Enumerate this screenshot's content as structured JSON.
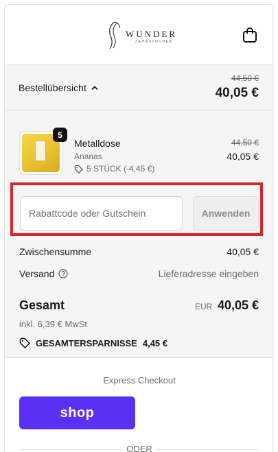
{
  "header": {
    "logo_text": "WUNDER",
    "logo_subtext": "ZAHNSTOCHER",
    "cart_icon": "shopping-bag-icon"
  },
  "summary": {
    "toggle_label": "Bestellübersicht",
    "toggle_icon": "chevron-up-icon",
    "original_total": "44,50 €",
    "total": "40,05 €"
  },
  "product": {
    "quantity": "5",
    "name": "Metalldose",
    "variant": "Ananas",
    "discount": "5 STÜCK (-4,45 €)",
    "original_price": "44,50 €",
    "price": "40,05 €"
  },
  "coupon": {
    "placeholder": "Rabattcode oder Gutschein",
    "apply_label": "Anwenden",
    "highlight_color": "#d9252a"
  },
  "totals": {
    "subtotal_label": "Zwischensumme",
    "subtotal_value": "40,05 €",
    "shipping_label": "Versand",
    "shipping_value": "Lieferadresse eingeben",
    "total_label": "Gesamt",
    "currency": "EUR",
    "total_value": "40,05 €",
    "tax_note": "inkl. 6,39 € MwSt",
    "savings_label": "GESAMTERSPARNISSE",
    "savings_value": "4,45 €"
  },
  "express": {
    "title": "Express Checkout",
    "shop_label": "shop",
    "shop_color": "#5a31f4",
    "divider_text": "ODER"
  }
}
